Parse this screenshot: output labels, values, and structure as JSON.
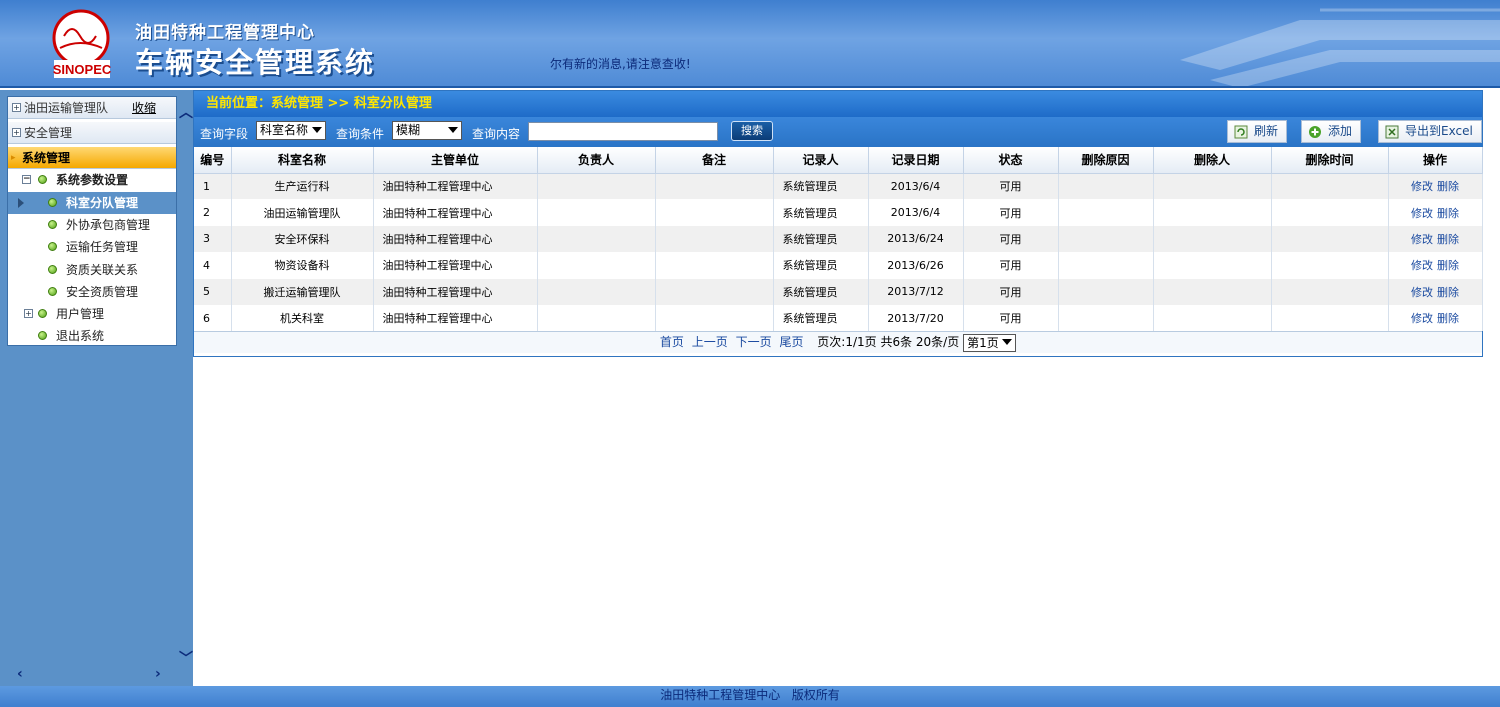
{
  "header": {
    "logo_text": "SINOPEC",
    "org_name": "油田特种工程管理中心",
    "system_name": "车辆安全管理系统",
    "notice": "尔有新的消息,请注意查收!"
  },
  "sidebar": {
    "items": [
      {
        "label": "油田运输管理队"
      },
      {
        "label": "安全管理"
      },
      {
        "label": "系统管理"
      }
    ],
    "collapse_label": "收缩",
    "tree": [
      {
        "label": "系统参数设置"
      },
      {
        "label": "科室分队管理"
      },
      {
        "label": "外协承包商管理"
      },
      {
        "label": "运输任务管理"
      },
      {
        "label": "资质关联关系"
      },
      {
        "label": "安全资质管理"
      },
      {
        "label": "用户管理"
      },
      {
        "label": "退出系统"
      }
    ]
  },
  "main": {
    "location": "当前位置：系统管理  >>  科室分队管理",
    "toolbar": {
      "field_label": "查询字段",
      "field_value": "科室名称",
      "condition_label": "查询条件",
      "condition_value": "模糊",
      "content_label": "查询内容",
      "content_value": "",
      "search_label": "搜索",
      "refresh_label": "刷新",
      "add_label": "添加",
      "export_label": "导出到Excel"
    },
    "columns": [
      "编号",
      "科室名称",
      "主管单位",
      "负责人",
      "备注",
      "记录人",
      "记录日期",
      "状态",
      "删除原因",
      "删除人",
      "删除时间",
      "操作"
    ],
    "rows": [
      {
        "id": "1",
        "name": "生产运行科",
        "unit": "油田特种工程管理中心",
        "head": "",
        "note": "",
        "recorder": "系统管理员",
        "date": "2013/6/4",
        "status": "可用",
        "del_reason": "",
        "del_by": "",
        "del_time": ""
      },
      {
        "id": "2",
        "name": "油田运输管理队",
        "unit": "油田特种工程管理中心",
        "head": "",
        "note": "",
        "recorder": "系统管理员",
        "date": "2013/6/4",
        "status": "可用",
        "del_reason": "",
        "del_by": "",
        "del_time": ""
      },
      {
        "id": "3",
        "name": "安全环保科",
        "unit": "油田特种工程管理中心",
        "head": "",
        "note": "",
        "recorder": "系统管理员",
        "date": "2013/6/24",
        "status": "可用",
        "del_reason": "",
        "del_by": "",
        "del_time": ""
      },
      {
        "id": "4",
        "name": "物资设备科",
        "unit": "油田特种工程管理中心",
        "head": "",
        "note": "",
        "recorder": "系统管理员",
        "date": "2013/6/26",
        "status": "可用",
        "del_reason": "",
        "del_by": "",
        "del_time": ""
      },
      {
        "id": "5",
        "name": "搬迁运输管理队",
        "unit": "油田特种工程管理中心",
        "head": "",
        "note": "",
        "recorder": "系统管理员",
        "date": "2013/7/12",
        "status": "可用",
        "del_reason": "",
        "del_by": "",
        "del_time": ""
      },
      {
        "id": "6",
        "name": "机关科室",
        "unit": "油田特种工程管理中心",
        "head": "",
        "note": "",
        "recorder": "系统管理员",
        "date": "2013/7/20",
        "status": "可用",
        "del_reason": "",
        "del_by": "",
        "del_time": ""
      }
    ],
    "actions": {
      "edit": "修改",
      "delete": "删除"
    },
    "pager": {
      "first": "首页",
      "prev": "上一页",
      "next": "下一页",
      "last": "尾页",
      "info": "页次:1/1页 共6条 20条/页",
      "page_select": "第1页"
    }
  },
  "footer": {
    "text": "油田特种工程管理中心   版权所有"
  },
  "colors": {
    "header_blue": "#4f8bd6",
    "sidebar_blue": "#5b91c8",
    "location_yellow": "#ffe600",
    "active_orange": "#f5a800"
  }
}
